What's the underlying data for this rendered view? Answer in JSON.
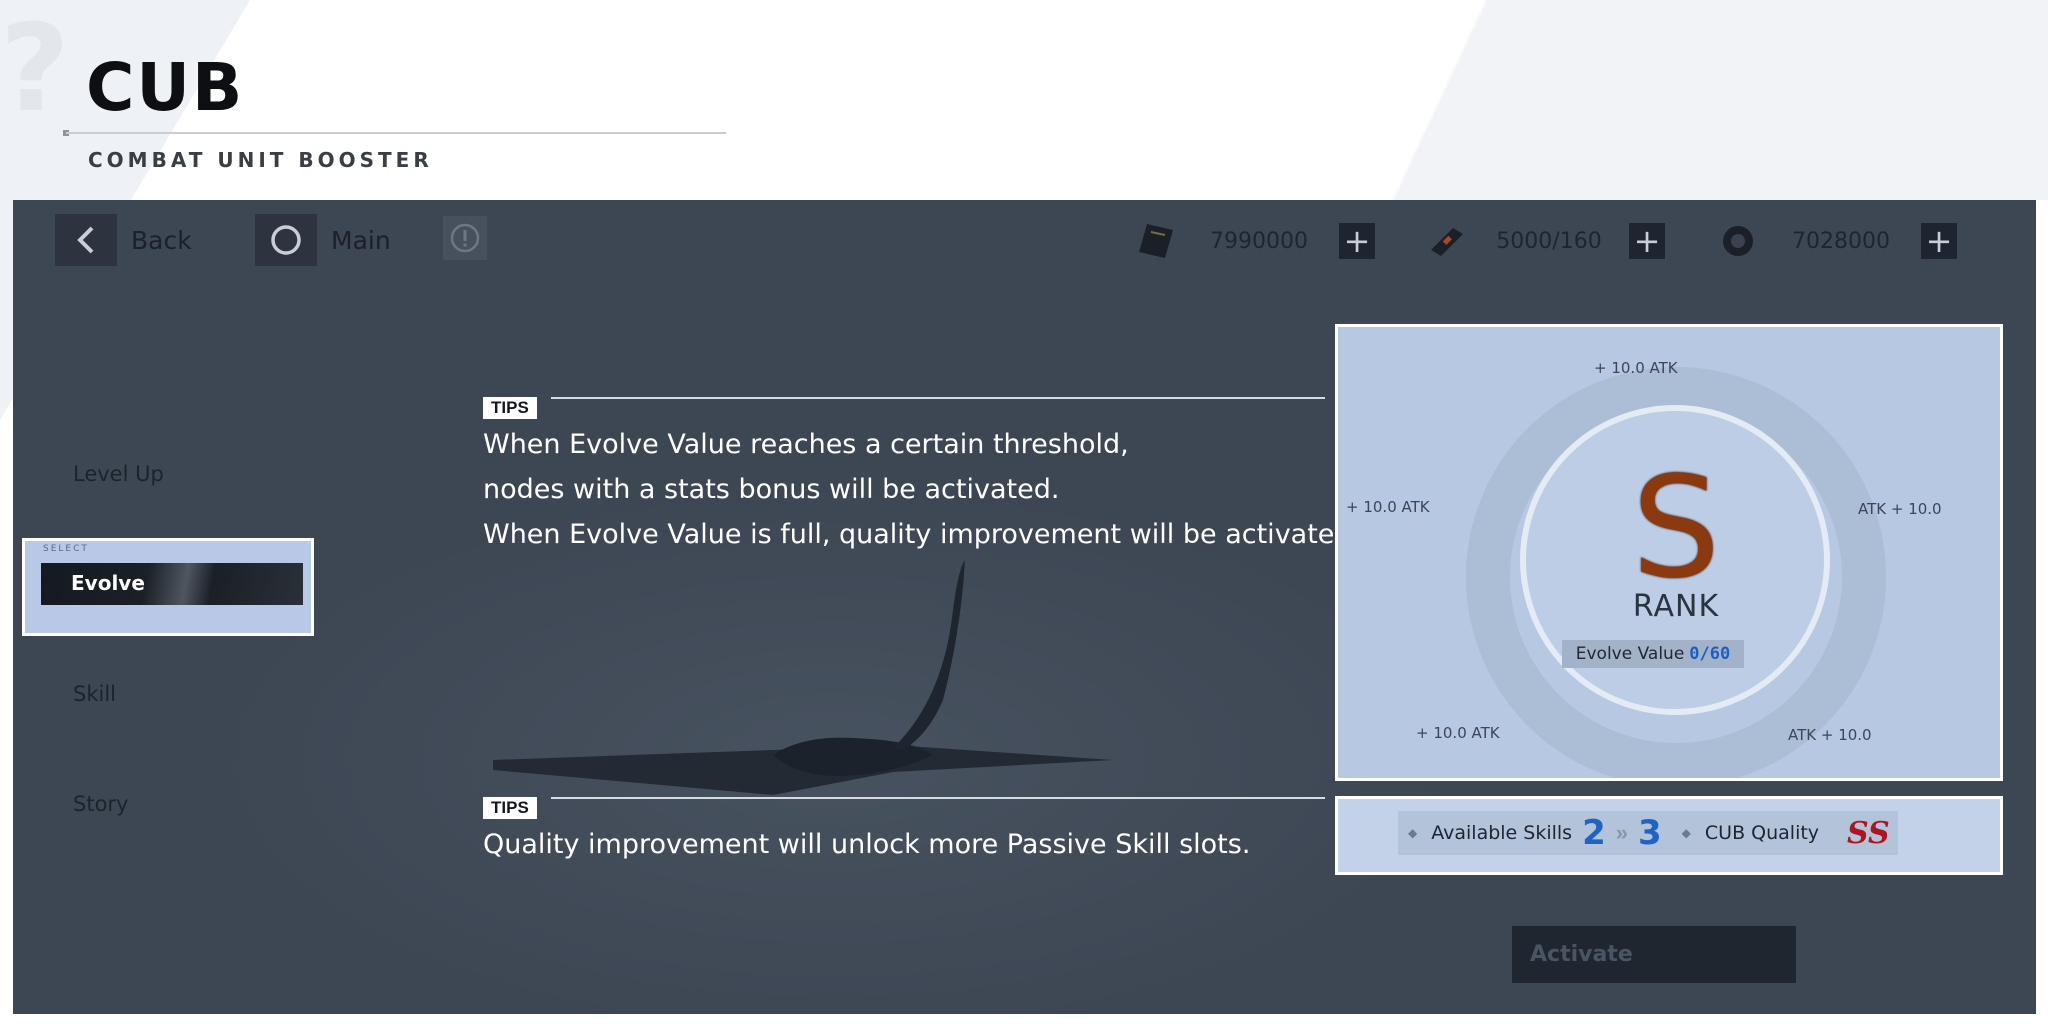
{
  "header": {
    "title": "CUB",
    "subtitle": "COMBAT UNIT BOOSTER"
  },
  "topbar": {
    "back_label": "Back",
    "main_label": "Main",
    "resources": [
      {
        "icon": "gem-card-icon",
        "value": "7990000"
      },
      {
        "icon": "battery-icon",
        "value": "5000/160"
      },
      {
        "icon": "credit-coin-icon",
        "value": "7028000"
      }
    ]
  },
  "sidebar": {
    "select_tag": "SELECT",
    "items": [
      {
        "label": "Level Up"
      },
      {
        "label": "Evolve",
        "selected": true
      },
      {
        "label": "Skill"
      },
      {
        "label": "Story"
      }
    ]
  },
  "tips": [
    {
      "tag": "TIPS",
      "lines": [
        "When Evolve Value reaches a certain threshold,",
        "nodes with a stats bonus will be activated.",
        "When Evolve Value is full, quality improvement will be activated."
      ]
    },
    {
      "tag": "TIPS",
      "lines": [
        "Quality improvement will unlock more Passive Skill slots."
      ]
    }
  ],
  "rank_panel": {
    "rank_letter": "S",
    "rank_word": "RANK",
    "evolve_label": "Evolve Value",
    "evolve_value": "0/60",
    "nodes": {
      "top": "+ 10.0 ATK",
      "left": "+ 10.0 ATK",
      "right": "ATK + 10.0",
      "bottom_left": "+ 10.0 ATK",
      "bottom_right": "ATK + 10.0"
    }
  },
  "skill_panel": {
    "available_label": "Available Skills",
    "from": "2",
    "arrow": "»",
    "to": "3",
    "quality_label": "CUB Quality",
    "quality_value": "SS"
  },
  "activate_label": "Activate",
  "colors": {
    "accent_blue": "#1f63c6",
    "rank_orange": "#8b3a10",
    "quality_red": "#b0141e"
  }
}
